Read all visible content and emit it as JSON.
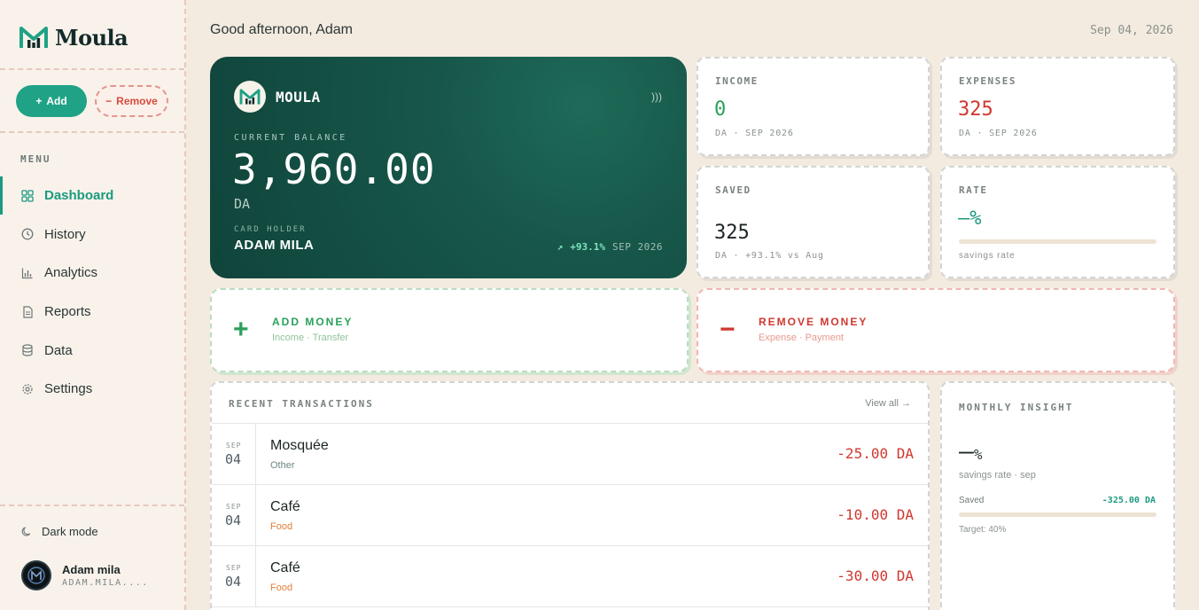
{
  "brand": {
    "name": "Moula",
    "card_brand": "MOULA"
  },
  "sidebar": {
    "add_label": "Add",
    "remove_label": "Remove",
    "menu_label": "MENU",
    "items": [
      {
        "label": "Dashboard",
        "icon": "dashboard-icon",
        "active": true
      },
      {
        "label": "History",
        "icon": "clock-icon"
      },
      {
        "label": "Analytics",
        "icon": "bar-chart-icon"
      },
      {
        "label": "Reports",
        "icon": "document-icon"
      },
      {
        "label": "Data",
        "icon": "database-icon"
      },
      {
        "label": "Settings",
        "icon": "gear-icon"
      }
    ],
    "dark_mode_label": "Dark mode",
    "user": {
      "name": "Adam mila",
      "handle": "ADAM.MILA...."
    }
  },
  "header": {
    "greeting": "Good afternoon, Adam",
    "date": "Sep 04, 2026"
  },
  "balance_card": {
    "label": "CURRENT BALANCE",
    "amount": "3,960.00",
    "currency": "DA",
    "holder_label": "CARD HOLDER",
    "holder": "ADAM MILA",
    "trend": "+93.1%",
    "period": "SEP 2026"
  },
  "stats": {
    "income": {
      "label": "INCOME",
      "value": "0",
      "sub": "DA · SEP 2026"
    },
    "expenses": {
      "label": "EXPENSES",
      "value": "325",
      "sub": "DA · SEP 2026"
    },
    "saved": {
      "label": "SAVED",
      "value": "325",
      "sub": "DA · +93.1% vs Aug"
    },
    "rate": {
      "label": "RATE",
      "value": "—%",
      "sub": "savings rate"
    }
  },
  "actions": {
    "add": {
      "title": "ADD MONEY",
      "sub": "Income · Transfer"
    },
    "remove": {
      "title": "REMOVE MONEY",
      "sub": "Expense · Payment"
    }
  },
  "transactions": {
    "title": "RECENT TRANSACTIONS",
    "view_all": "View all →",
    "rows": [
      {
        "month": "SEP",
        "day": "04",
        "name": "Mosquée",
        "category": "Other",
        "amount": "-25.00 DA"
      },
      {
        "month": "SEP",
        "day": "04",
        "name": "Café",
        "category": "Food",
        "amount": "-10.00 DA"
      },
      {
        "month": "SEP",
        "day": "04",
        "name": "Café",
        "category": "Food",
        "amount": "-30.00 DA"
      }
    ]
  },
  "insight": {
    "title": "MONTHLY INSIGHT",
    "value": "—",
    "pct": "%",
    "sub": "savings rate · sep",
    "saved_label": "Saved",
    "saved_value": "-325.00 DA",
    "target": "Target: 40%"
  },
  "colors": {
    "accent": "#1fa286",
    "danger": "#d0382e",
    "income_green": "#2aa05c",
    "card_dark": "#10443b"
  }
}
